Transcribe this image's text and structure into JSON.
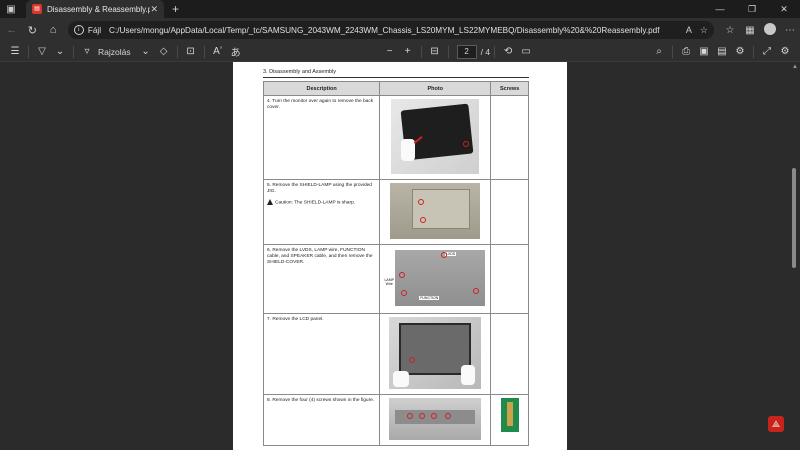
{
  "browser": {
    "tab": {
      "title": "Disassembly & Reassembly.pdf",
      "close": "✕"
    },
    "new_tab": "+",
    "window": {
      "minimize": "—",
      "restore": "❐",
      "close": "✕"
    },
    "address": {
      "scheme_label": "Fájl",
      "url": "C:/Users/mongu/AppData/Local/Temp/_tc/SAMSUNG_2043WM_2243WM_Chassis_LS20MYM_LS22MYMEBQ/Disassembly%20&%20Reassembly.pdf"
    }
  },
  "pdf_toolbar": {
    "draw_label": "Rajzolás",
    "page_current": "2",
    "page_total": "/ 4",
    "zoom_out": "−",
    "zoom_in": "+"
  },
  "document": {
    "section_title": "3. Disassembly and Assembly",
    "columns": [
      "Description",
      "Photo",
      "Screws"
    ],
    "steps": [
      {
        "text": "4.  Turn the monitor over again to remove the back cover."
      },
      {
        "text": "5.  Remove the SHIELD-LAMP using the provided JIG.",
        "caution": "Caution: The SHIELD-LAMP is sharp."
      },
      {
        "text": "6.  Remove the LVDS, LAMP wire, FUNCTION cable, and SPEAKER cable, and then remove the SHIELD-COVER."
      },
      {
        "text": "7.  Remove the LCD panel."
      },
      {
        "text": "8.  Remove the four (4) screws shown in the figure."
      }
    ],
    "photo_labels": {
      "lvds": "LVDS",
      "lamp_wire": "LAMP Wire",
      "function": "FUNCTION"
    }
  },
  "colors": {
    "accent": "#d9352b",
    "background": "#2b2b2b"
  }
}
